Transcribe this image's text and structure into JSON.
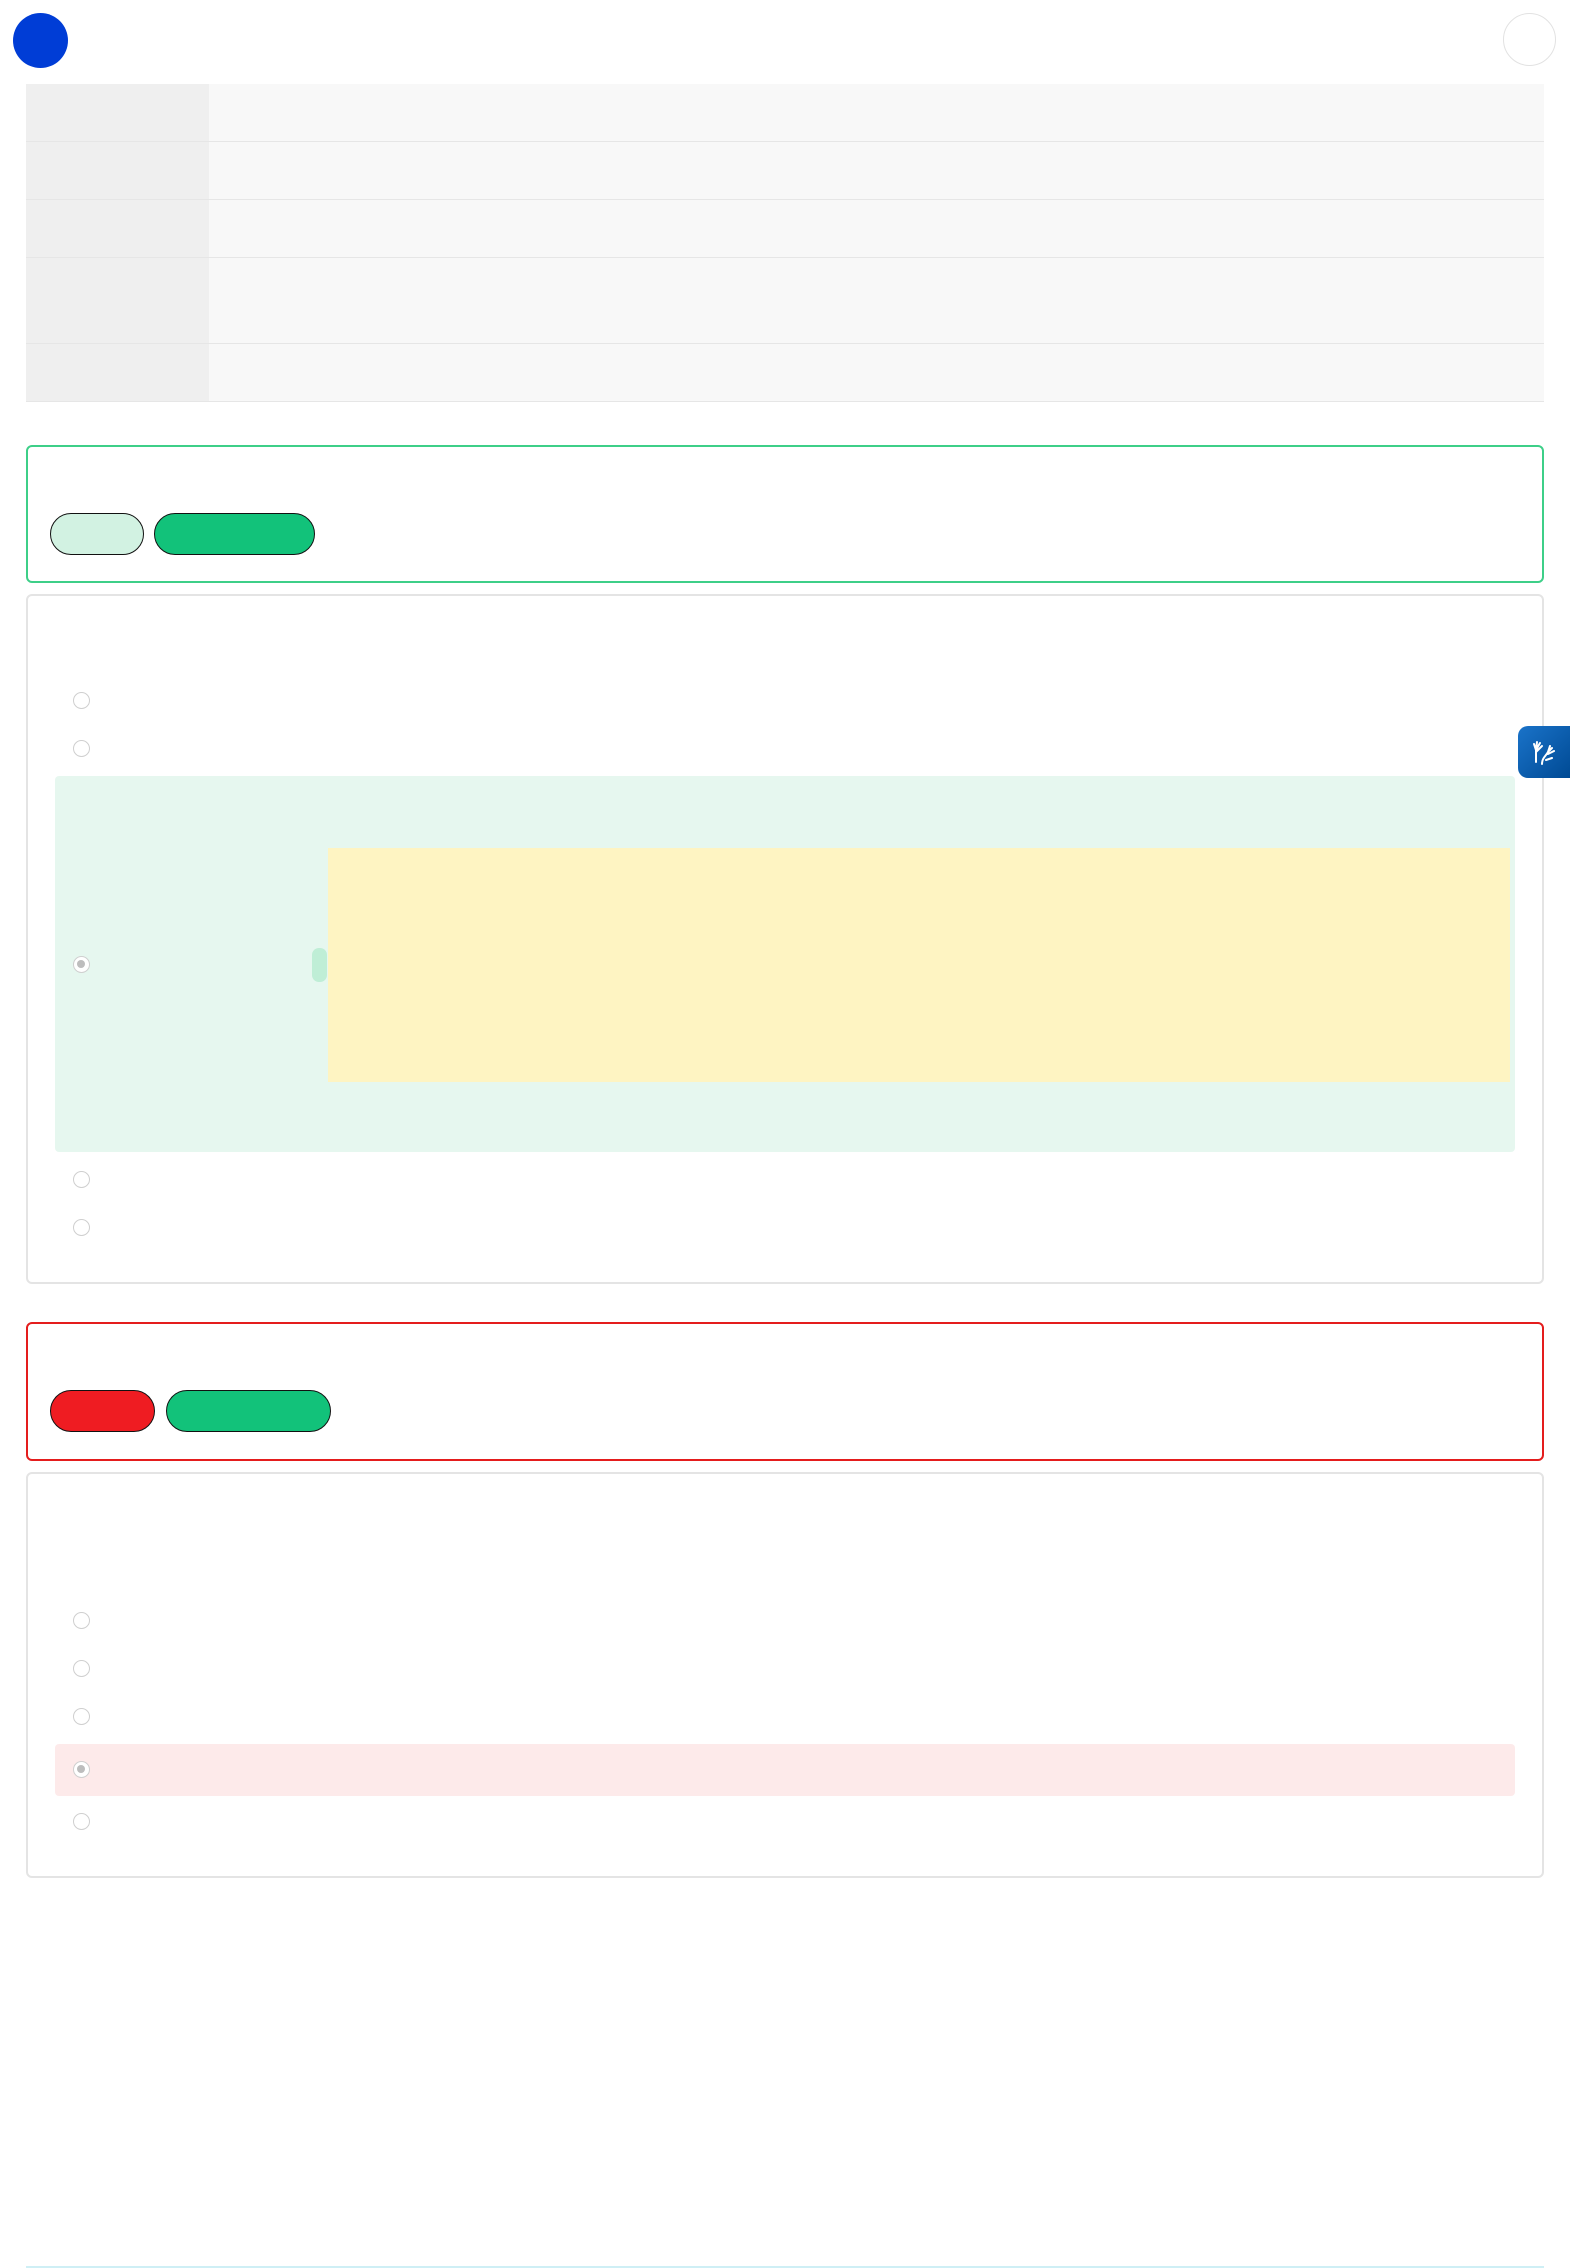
{
  "header": {
    "avatar": "",
    "close": ""
  },
  "summary_rows": [
    {
      "label": "",
      "value": ""
    },
    {
      "label": "",
      "value": ""
    },
    {
      "label": "",
      "value": ""
    },
    {
      "label": "",
      "value": ""
    },
    {
      "label": "",
      "value": ""
    }
  ],
  "questions": [
    {
      "result": "correct",
      "status_label": "",
      "points_label": "",
      "question_text": "",
      "options": [
        "",
        "",
        "",
        "",
        ""
      ],
      "selected_index": 2,
      "explanation": ""
    },
    {
      "result": "incorrect",
      "status_label": "",
      "points_label": "",
      "question_text": "",
      "options": [
        "",
        "",
        "",
        "",
        ""
      ],
      "selected_index": 3
    }
  ],
  "accessibility": {
    "icon": "sign-language-hands-icon"
  },
  "colors": {
    "brand": "#003dd6",
    "correct_border": "#3dcf88",
    "correct_bg": "#e6f7ef",
    "incorrect_border": "#e41d1d",
    "incorrect_bg": "#fdeaea",
    "points_badge": "#12c27a",
    "explanation_bg": "#fef4c2"
  }
}
